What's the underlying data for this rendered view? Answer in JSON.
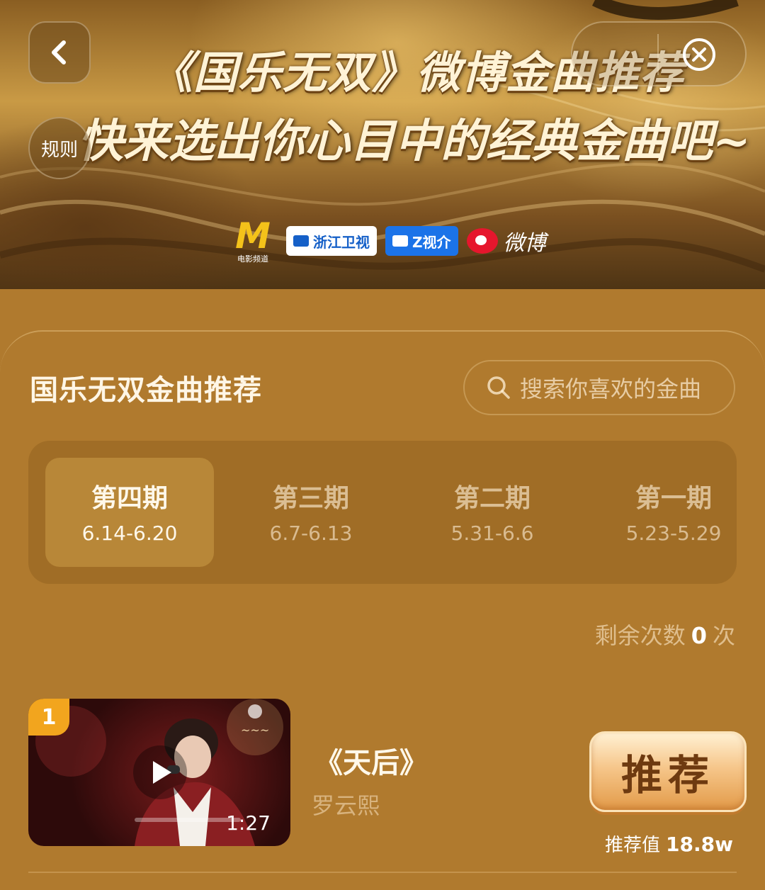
{
  "banner": {
    "title": "《国乐无双》微博金曲推荐",
    "subtitle": "快来选出你心目中的经典金曲吧~",
    "rules_label": "规则",
    "sponsor_logos": {
      "movie_channel_mark": "M",
      "movie_channel_caption": "电影频道",
      "zhejiang_tv": "浙江卫视",
      "zview": "Z视介",
      "weibo": "微博"
    }
  },
  "section": {
    "title": "国乐无双金曲推荐",
    "search_placeholder": "搜索你喜欢的金曲"
  },
  "periods": [
    {
      "name": "第四期",
      "dates": "6.14-6.20",
      "active": true
    },
    {
      "name": "第三期",
      "dates": "6.7-6.13",
      "active": false
    },
    {
      "name": "第二期",
      "dates": "5.31-6.6",
      "active": false
    },
    {
      "name": "第一期",
      "dates": "5.23-5.29",
      "active": false
    }
  ],
  "remaining": {
    "label": "剩余次数",
    "count": "0",
    "unit": "次"
  },
  "songs": [
    {
      "rank": "1",
      "title": "《天后》",
      "artist": "罗云熙",
      "duration": "1:27",
      "button_label": "推荐",
      "value_label": "推荐值",
      "value": "18.8w"
    }
  ],
  "colors": {
    "page_bg": "#b07a2e",
    "rank_badge": "#f2a51e",
    "button_text": "#6e3a10"
  }
}
